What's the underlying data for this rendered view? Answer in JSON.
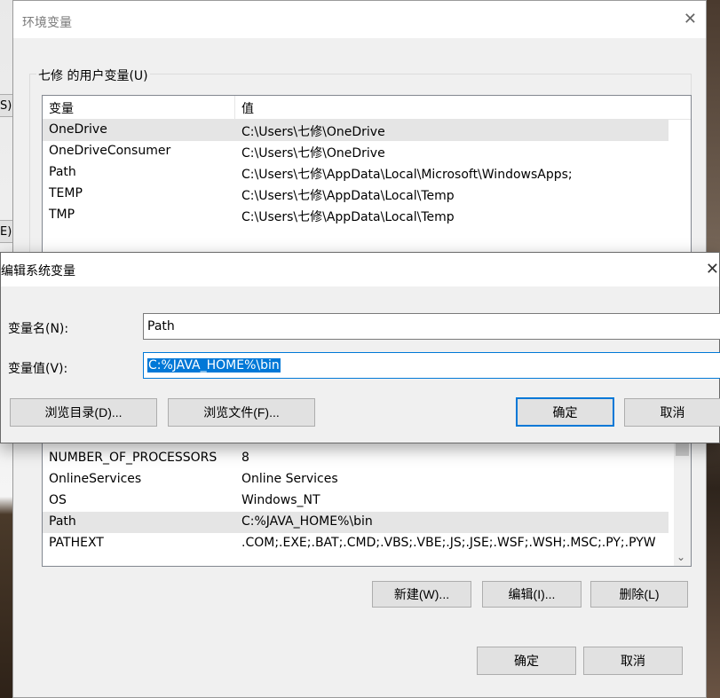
{
  "env_window": {
    "title": "环境变量",
    "close": "✕",
    "user_group_label": "七修 的用户变量(U)",
    "user_vars": {
      "headers": [
        "变量",
        "值"
      ],
      "rows": [
        {
          "name": "OneDrive",
          "value": "C:\\Users\\七修\\OneDrive"
        },
        {
          "name": "OneDriveConsumer",
          "value": "C:\\Users\\七修\\OneDrive"
        },
        {
          "name": "Path",
          "value": "C:\\Users\\七修\\AppData\\Local\\Microsoft\\WindowsApps;"
        },
        {
          "name": "TEMP",
          "value": "C:\\Users\\七修\\AppData\\Local\\Temp"
        },
        {
          "name": "TMP",
          "value": "C:\\Users\\七修\\AppData\\Local\\Temp"
        }
      ]
    },
    "system_vars": {
      "rows": [
        {
          "name": "NUMBER_OF_PROCESSORS",
          "value": "8"
        },
        {
          "name": "OnlineServices",
          "value": "Online Services"
        },
        {
          "name": "OS",
          "value": "Windows_NT"
        },
        {
          "name": "Path",
          "value": "C:%JAVA_HOME%\\bin"
        },
        {
          "name": "PATHEXT",
          "value": ".COM;.EXE;.BAT;.CMD;.VBS;.VBE;.JS;.JSE;.WSF;.WSH;.MSC;.PY;.PYW"
        }
      ]
    },
    "buttons": {
      "new": "新建(W)...",
      "edit": "编辑(I)...",
      "delete": "删除(L)",
      "ok": "确定",
      "cancel": "取消"
    },
    "left_fragments": [
      "S).",
      "E)."
    ]
  },
  "edit_dialog": {
    "title": "编辑系统变量",
    "close": "✕",
    "name_label": "变量名(N):",
    "name_value": "Path",
    "value_label": "变量值(V):",
    "value_value": "C:%JAVA_HOME%\\bin",
    "buttons": {
      "browse_dir": "浏览目录(D)...",
      "browse_file": "浏览文件(F)...",
      "ok": "确定",
      "cancel": "取消"
    }
  },
  "colors": {
    "accent": "#0078d7",
    "dialog_bg": "#f0f0f0",
    "button_bg": "#e1e1e1"
  }
}
